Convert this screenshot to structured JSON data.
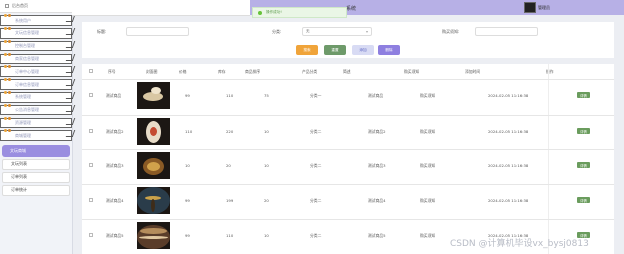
{
  "sidebar": {
    "home": "后台首页",
    "menus": [
      "系统用户",
      "文玩信息管理",
      "控制台管理",
      "商家信息管理",
      "订单中心管理",
      "订单信息管理",
      "系统管理",
      "公告消息管理",
      "资源管理",
      "商城管理"
    ],
    "active": "文玩商城",
    "subs": [
      "文玩列表",
      "订单列表",
      "订单统计"
    ]
  },
  "topbar": {
    "title": "系统",
    "user": "管理员"
  },
  "toast": "操作成功!",
  "filters": {
    "label1": "标题:",
    "label2": "分类:",
    "select_value": "无",
    "label3": "购买须知:",
    "buttons": [
      "搜索",
      "重置",
      "添加",
      "删除"
    ]
  },
  "table": {
    "headers": [
      "序号",
      "封面图",
      "价格",
      "库存",
      "商品排序",
      "产品分类",
      "简述",
      "购买须知",
      "添加时间",
      "操作"
    ],
    "rows": [
      {
        "name": "测试商品",
        "price": "99",
        "stock": "110",
        "sort": "75",
        "cat": "分类一",
        "desc": "测试商品",
        "notice": "购买须知",
        "time": "2024-02-05 11:16:38"
      },
      {
        "name": "测试商品2",
        "price": "110",
        "stock": "220",
        "sort": "10",
        "cat": "分类二",
        "desc": "测试商品2",
        "notice": "购买须知",
        "time": "2024-02-05 11:16:38"
      },
      {
        "name": "测试商品3",
        "price": "10",
        "stock": "20",
        "sort": "10",
        "cat": "分类二",
        "desc": "测试商品3",
        "notice": "购买须知",
        "time": "2024-02-05 11:16:38"
      },
      {
        "name": "测试商品4",
        "price": "99",
        "stock": "199",
        "sort": "20",
        "cat": "分类二",
        "desc": "测试商品4",
        "notice": "购买须知",
        "time": "2024-02-05 11:16:38"
      },
      {
        "name": "测试商品5",
        "price": "99",
        "stock": "110",
        "sort": "10",
        "cat": "分类二",
        "desc": "测试商品5",
        "notice": "购买须知",
        "time": "2024-02-05 11:16:38"
      }
    ],
    "action": "详情"
  },
  "watermark": "CSDN @计算机毕设vx_bysj0813",
  "colors": {
    "accent": "#9a8ee0",
    "search": "#f0a43a",
    "reset": "#6e9a6a",
    "add": "#d8dbf4",
    "delete": "#8e7fe0",
    "detail": "#6a9c5d"
  }
}
